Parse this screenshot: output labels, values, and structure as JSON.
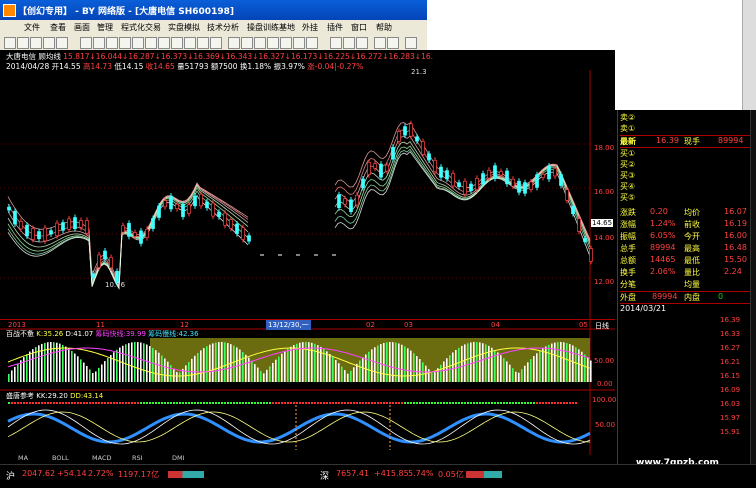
{
  "window": {
    "title": "【创幻专用】 - BY 网络版 - [大唐电信 SH600198]"
  },
  "menu": [
    "文件",
    "查看",
    "画面",
    "管理",
    "程式化交易",
    "实盘模拟",
    "技术分析",
    "操盘训练基地",
    "外挂",
    "插件",
    "窗口",
    "帮助"
  ],
  "main_chart": {
    "name": "大唐电信",
    "indicator": "顾均线",
    "ma_values": "15.817↓16.044↓16.287↓16.373↓16.369↓16.343↓16.327↓16.173↓16.225↓16.272↓16.283↓16.",
    "date": "2014/04/28",
    "open": "开14.55",
    "high": "高14.73",
    "low": "低14.15",
    "close": "收14.65",
    "vol": "量51793",
    "amt": "额7500",
    "turn": "换1.18%",
    "amp": "振3.97%",
    "chg": "涨-0.04|-0.27%",
    "high_mark": "21.3",
    "low_mark": "10.76",
    "last_price_tag": "14.65",
    "y_axis": [
      "18.00",
      "16.00",
      "14.00",
      "12.00"
    ],
    "x_axis": [
      "2013",
      "11",
      "12",
      "13/12/30,一",
      "02",
      "03",
      "04",
      "05"
    ],
    "period": "日线"
  },
  "panel2": {
    "name": "百战不惫",
    "k": "K:35.26",
    "d": "D:41.07",
    "fast": "筹码快线:39.99",
    "slow": "筹码慢线:42.36",
    "y_axis": [
      "50.00",
      "0.00"
    ]
  },
  "panel3": {
    "name": "盛唐参考",
    "kk": "KK:29.20",
    "dd": "DD:43.14",
    "y_axis": [
      "100.00",
      "50.00"
    ]
  },
  "tabs": [
    "MA",
    "BOLL",
    "MACD",
    "RSI",
    "DMI"
  ],
  "quote": {
    "sell": [
      "卖②",
      "卖①"
    ],
    "latest_label": "最新",
    "latest": "16.39",
    "now_hand_label": "现手",
    "now_hand": "89994",
    "buy": [
      "买①",
      "买②",
      "买③",
      "买④",
      "买⑤"
    ],
    "rows": [
      {
        "l1": "涨跌",
        "v1": "0.20",
        "l2": "均价",
        "v2": "16.07"
      },
      {
        "l1": "涨幅",
        "v1": "1.24%",
        "l2": "前收",
        "v2": "16.19"
      },
      {
        "l1": "振幅",
        "v1": "6.05%",
        "l2": "今开",
        "v2": "16.00"
      },
      {
        "l1": "总手",
        "v1": "89994",
        "l2": "最高",
        "v2": "16.48"
      },
      {
        "l1": "总额",
        "v1": "14465",
        "l2": "最低",
        "v2": "15.50"
      },
      {
        "l1": "换手",
        "v1": "2.06%",
        "l2": "量比",
        "v2": "2.24"
      },
      {
        "l1": "分笔",
        "v1": "",
        "l2": "均量",
        "v2": ""
      }
    ],
    "outer_label": "外盘",
    "outer": "89994",
    "inner_label": "内盘",
    "inner": "0",
    "date": "2014/03/21",
    "ticks": [
      "16.39",
      "16.33",
      "16.27",
      "16.21",
      "16.15",
      "16.09",
      "16.03",
      "15.97",
      "15.91"
    ]
  },
  "status": {
    "sh_label": "沪",
    "sh_val": "2047.62",
    "sh_chg": "+54.14",
    "sh_pct": "2.72%",
    "sh_amt": "1197.17亿",
    "sz_label": "深",
    "sz_val": "7657.41",
    "sz_chg": "+415.85",
    "sz_pct": "5.74%",
    "sz_amt": "0.05亿"
  },
  "watermark": "www.7gpzb.com"
}
